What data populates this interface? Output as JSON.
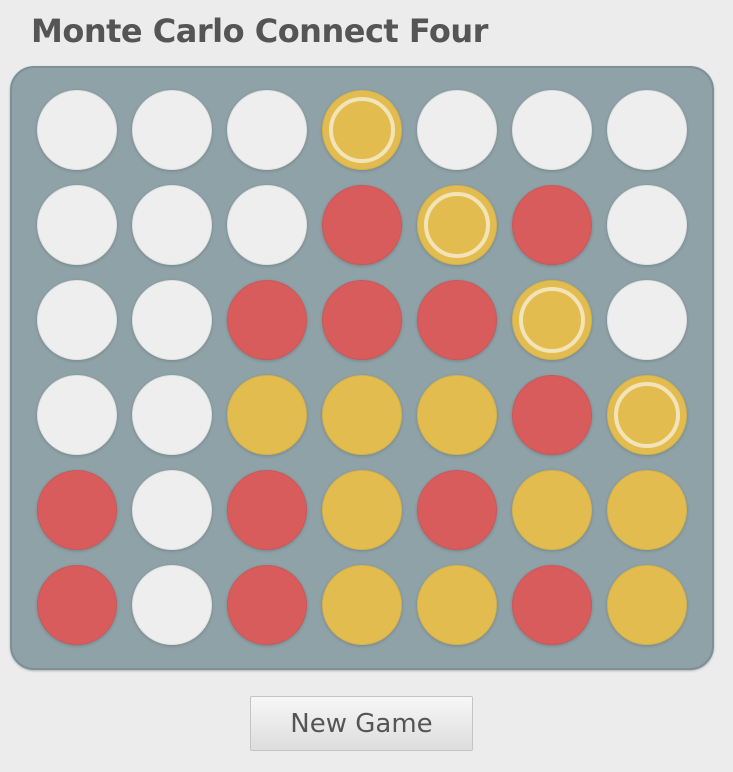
{
  "app": {
    "title": "Monte Carlo Connect Four"
  },
  "colors": {
    "empty": "#eeeeee",
    "red": "#d85c5c",
    "yellow": "#e2bc4e",
    "board": "#8ea2a8",
    "highlight_ring": "#f2e4b8"
  },
  "board": {
    "columns": 7,
    "rows": 6,
    "cells": [
      [
        "empty",
        "empty",
        "empty",
        "yellow",
        "empty",
        "empty",
        "empty"
      ],
      [
        "empty",
        "empty",
        "empty",
        "red",
        "yellow",
        "red",
        "empty"
      ],
      [
        "empty",
        "empty",
        "red",
        "red",
        "red",
        "yellow",
        "empty"
      ],
      [
        "empty",
        "empty",
        "yellow",
        "yellow",
        "yellow",
        "red",
        "yellow"
      ],
      [
        "red",
        "empty",
        "red",
        "yellow",
        "red",
        "yellow",
        "yellow"
      ],
      [
        "red",
        "empty",
        "red",
        "yellow",
        "yellow",
        "red",
        "yellow"
      ]
    ],
    "winning_cells": [
      [
        0,
        3
      ],
      [
        1,
        4
      ],
      [
        2,
        5
      ],
      [
        3,
        6
      ]
    ]
  },
  "controls": {
    "new_game_label": "New Game"
  }
}
